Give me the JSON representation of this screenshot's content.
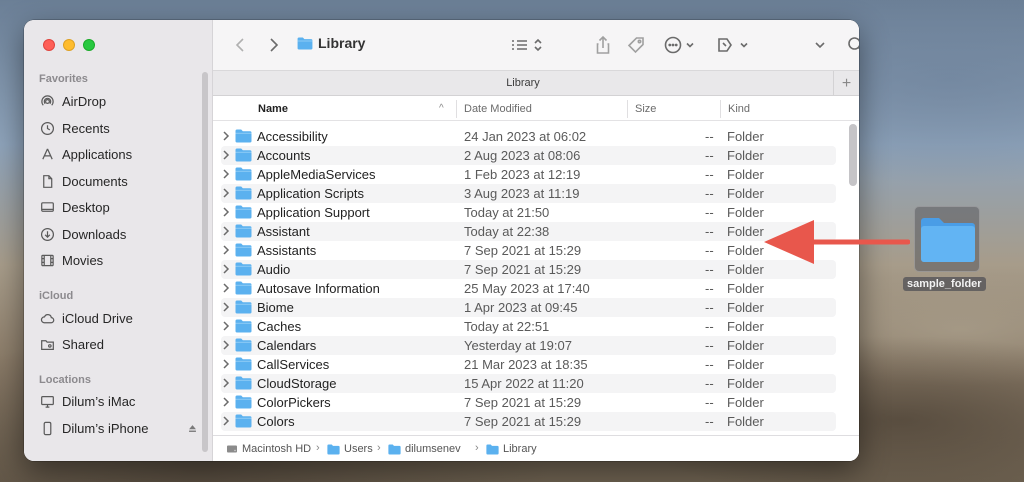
{
  "window": {
    "title": "Library",
    "tab_title": "Library",
    "tab_add": "+"
  },
  "sidebar": {
    "sections": [
      {
        "label": "Favorites"
      },
      {
        "label": "iCloud"
      },
      {
        "label": "Locations"
      }
    ],
    "favorites": [
      {
        "label": "AirDrop",
        "icon": "airdrop-icon"
      },
      {
        "label": "Recents",
        "icon": "clock-icon"
      },
      {
        "label": "Applications",
        "icon": "applications-icon"
      },
      {
        "label": "Documents",
        "icon": "document-icon"
      },
      {
        "label": "Desktop",
        "icon": "desktop-icon"
      },
      {
        "label": "Downloads",
        "icon": "download-icon"
      },
      {
        "label": "Movies",
        "icon": "film-icon"
      }
    ],
    "icloud": [
      {
        "label": "iCloud Drive",
        "icon": "cloud-icon"
      },
      {
        "label": "Shared",
        "icon": "shared-folder-icon"
      }
    ],
    "locations": [
      {
        "label": "Dilum’s iMac",
        "icon": "imac-icon"
      },
      {
        "label": "Dilum’s iPhone",
        "icon": "iphone-icon"
      }
    ]
  },
  "columns": {
    "name": "Name",
    "date": "Date Modified",
    "size": "Size",
    "kind": "Kind"
  },
  "files": [
    {
      "name": "Accessibility",
      "date": "24 Jan 2023 at 06:02",
      "size": "--",
      "kind": "Folder"
    },
    {
      "name": "Accounts",
      "date": "2 Aug 2023 at 08:06",
      "size": "--",
      "kind": "Folder"
    },
    {
      "name": "AppleMediaServices",
      "date": "1 Feb 2023 at 12:19",
      "size": "--",
      "kind": "Folder"
    },
    {
      "name": "Application Scripts",
      "date": "3 Aug 2023 at 11:19",
      "size": "--",
      "kind": "Folder"
    },
    {
      "name": "Application Support",
      "date": "Today at 21:50",
      "size": "--",
      "kind": "Folder"
    },
    {
      "name": "Assistant",
      "date": "Today at 22:38",
      "size": "--",
      "kind": "Folder"
    },
    {
      "name": "Assistants",
      "date": "7 Sep 2021 at 15:29",
      "size": "--",
      "kind": "Folder"
    },
    {
      "name": "Audio",
      "date": "7 Sep 2021 at 15:29",
      "size": "--",
      "kind": "Folder"
    },
    {
      "name": "Autosave Information",
      "date": "25 May 2023 at 17:40",
      "size": "--",
      "kind": "Folder"
    },
    {
      "name": "Biome",
      "date": "1 Apr 2023 at 09:45",
      "size": "--",
      "kind": "Folder"
    },
    {
      "name": "Caches",
      "date": "Today at 22:51",
      "size": "--",
      "kind": "Folder"
    },
    {
      "name": "Calendars",
      "date": "Yesterday at 19:07",
      "size": "--",
      "kind": "Folder"
    },
    {
      "name": "CallServices",
      "date": "21 Mar 2023 at 18:35",
      "size": "--",
      "kind": "Folder"
    },
    {
      "name": "CloudStorage",
      "date": "15 Apr 2022 at 11:20",
      "size": "--",
      "kind": "Folder"
    },
    {
      "name": "ColorPickers",
      "date": "7 Sep 2021 at 15:29",
      "size": "--",
      "kind": "Folder"
    },
    {
      "name": "Colors",
      "date": "7 Sep 2021 at 15:29",
      "size": "--",
      "kind": "Folder"
    }
  ],
  "pathbar": [
    {
      "label": "Macintosh HD",
      "icon": "hard-drive-icon"
    },
    {
      "label": "Users",
      "icon": "folder-icon"
    },
    {
      "label": "dilumsenev",
      "icon": "home-folder-icon"
    },
    {
      "label": "Library",
      "icon": "folder-icon"
    }
  ],
  "desktop": {
    "item_label": "sample_folder"
  },
  "colors": {
    "folder": "#5bb1ef",
    "arrow": "#e8574c",
    "accent": "#2f7ef6"
  }
}
